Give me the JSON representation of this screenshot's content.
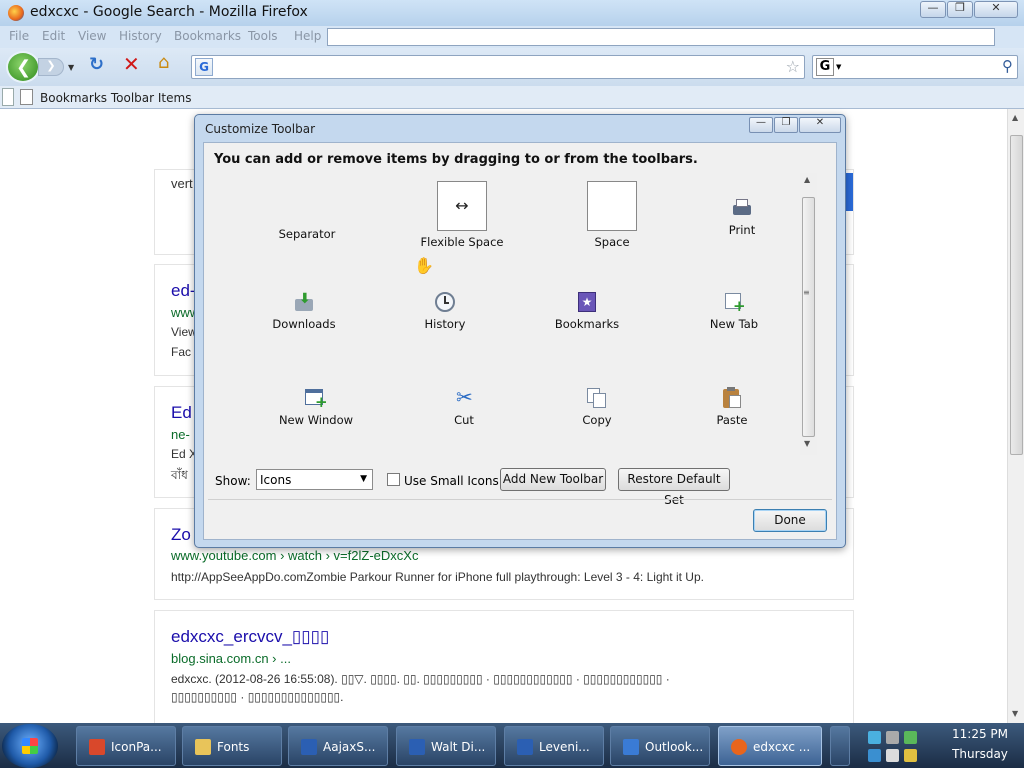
{
  "window": {
    "title": "edxcxc - Google Search - Mozilla Firefox",
    "minimize_glyph": "—",
    "maximize_glyph": "❐",
    "close_glyph": "✕"
  },
  "menubar": {
    "items": [
      "File",
      "Edit",
      "View",
      "History",
      "Bookmarks",
      "Tools",
      "Help"
    ]
  },
  "navbar": {
    "url_value": "",
    "search_engine": "G",
    "search_value": ""
  },
  "bookmarks_toolbar": {
    "label": "Bookmarks Toolbar Items"
  },
  "page": {
    "partial_top_text": "vert",
    "results": [
      {
        "title": "ed-",
        "url": "www",
        "desc1": "View",
        "desc2": "Fac"
      },
      {
        "title": "Ed",
        "url": "ne-",
        "desc1": "Ed X",
        "desc2": "বাঁধ"
      },
      {
        "title": "Zo",
        "url": "www.youtube.com › watch › v=f2lZ-eDxcXc",
        "desc1": "http://AppSeeAppDo.comZombie Parkour Runner for iPhone full playthrough: Level 3 - 4: Light it Up."
      },
      {
        "title": "edxcxc_ercvcv_▯▯▯▯",
        "url": "blog.sina.com.cn › ...",
        "desc1": "edxcxc. (2012-08-26 16:55:08). ▯▯▽. ▯▯▯▯. ▯▯. ▯▯▯▯▯▯▯▯▯ · ▯▯▯▯▯▯▯▯▯▯▯▯ · ▯▯▯▯▯▯▯▯▯▯▯▯ ·",
        "desc2": "▯▯▯▯▯▯▯▯▯▯ · ▯▯▯▯▯▯▯▯▯▯▯▯▯▯."
      }
    ]
  },
  "dialog": {
    "title": "Customize Toolbar",
    "instruction": "You can add or remove items by dragging to or from the toolbars.",
    "palette": [
      {
        "label": "Separator",
        "icon": "separator-icon"
      },
      {
        "label": "Flexible Space",
        "icon": "flexible-space-icon",
        "glyph": "↔"
      },
      {
        "label": "Space",
        "icon": "space-icon"
      },
      {
        "label": "Print",
        "icon": "print-icon"
      },
      {
        "label": "Downloads",
        "icon": "downloads-icon"
      },
      {
        "label": "History",
        "icon": "history-icon"
      },
      {
        "label": "Bookmarks",
        "icon": "bookmarks-icon"
      },
      {
        "label": "New Tab",
        "icon": "new-tab-icon"
      },
      {
        "label": "New Window",
        "icon": "new-window-icon"
      },
      {
        "label": "Cut",
        "icon": "cut-icon"
      },
      {
        "label": "Copy",
        "icon": "copy-icon"
      },
      {
        "label": "Paste",
        "icon": "paste-icon"
      }
    ],
    "show_label": "Show:",
    "show_value": "Icons",
    "small_icons_label": "Use Small Icons",
    "small_icons_checked": false,
    "add_toolbar_label": "Add New Toolbar",
    "restore_label": "Restore Default Set",
    "done_label": "Done"
  },
  "taskbar": {
    "items": [
      {
        "label": "IconPa...",
        "icon": "iconpackager-icon",
        "color": "#d9482b"
      },
      {
        "label": "Fonts",
        "icon": "folder-icon",
        "color": "#e8c45a"
      },
      {
        "label": "AajaxS...",
        "icon": "word-icon",
        "color": "#2b5fb3"
      },
      {
        "label": "Walt Di...",
        "icon": "word-icon",
        "color": "#2b5fb3"
      },
      {
        "label": "Leveni...",
        "icon": "word-icon",
        "color": "#2b5fb3"
      },
      {
        "label": "Outlook...",
        "icon": "outlook-icon",
        "color": "#3a7bd5"
      },
      {
        "label": "edxcxc ...",
        "icon": "firefox-icon",
        "color": "#e8651c"
      }
    ],
    "time": "11:25 PM",
    "day": "Thursday"
  }
}
